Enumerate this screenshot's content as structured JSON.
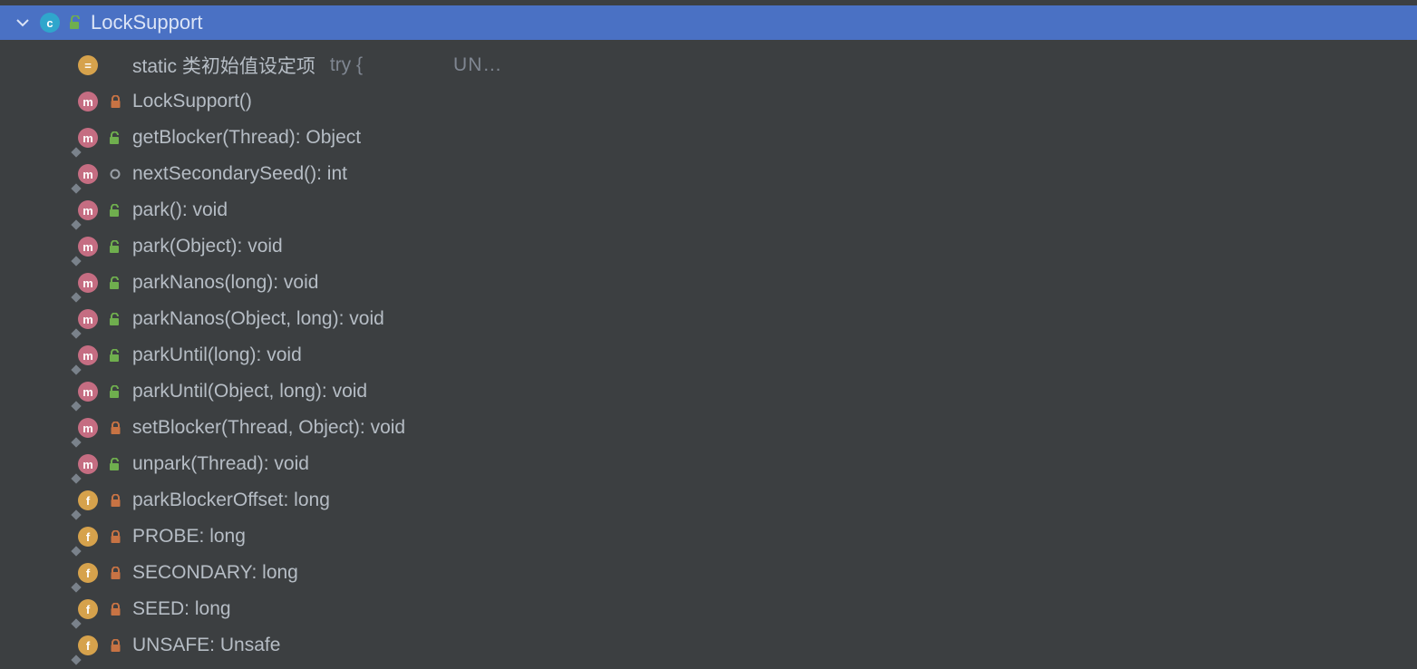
{
  "header": {
    "badge_letter": "c",
    "title": "LockSupport"
  },
  "members": [
    {
      "kind": "initializer",
      "access": "none",
      "label": "static 类初始值设定项",
      "hint": "try {",
      "hint2": "UN…"
    },
    {
      "kind": "method",
      "access": "private",
      "overlay": false,
      "label": "LockSupport()"
    },
    {
      "kind": "method",
      "access": "public",
      "overlay": true,
      "label": "getBlocker(Thread): Object"
    },
    {
      "kind": "method",
      "access": "package",
      "overlay": true,
      "label": "nextSecondarySeed(): int"
    },
    {
      "kind": "method",
      "access": "public",
      "overlay": true,
      "label": "park(): void"
    },
    {
      "kind": "method",
      "access": "public",
      "overlay": true,
      "label": "park(Object): void"
    },
    {
      "kind": "method",
      "access": "public",
      "overlay": true,
      "label": "parkNanos(long): void"
    },
    {
      "kind": "method",
      "access": "public",
      "overlay": true,
      "label": "parkNanos(Object, long): void"
    },
    {
      "kind": "method",
      "access": "public",
      "overlay": true,
      "label": "parkUntil(long): void"
    },
    {
      "kind": "method",
      "access": "public",
      "overlay": true,
      "label": "parkUntil(Object, long): void"
    },
    {
      "kind": "method",
      "access": "private",
      "overlay": true,
      "label": "setBlocker(Thread, Object): void"
    },
    {
      "kind": "method",
      "access": "public",
      "overlay": true,
      "label": "unpark(Thread): void"
    },
    {
      "kind": "field",
      "access": "private",
      "overlay": true,
      "label": "parkBlockerOffset: long"
    },
    {
      "kind": "field",
      "access": "private",
      "overlay": true,
      "label": "PROBE: long"
    },
    {
      "kind": "field",
      "access": "private",
      "overlay": true,
      "label": "SECONDARY: long"
    },
    {
      "kind": "field",
      "access": "private",
      "overlay": true,
      "label": "SEED: long"
    },
    {
      "kind": "field",
      "access": "private",
      "overlay": true,
      "label": "UNSAFE: Unsafe"
    }
  ]
}
